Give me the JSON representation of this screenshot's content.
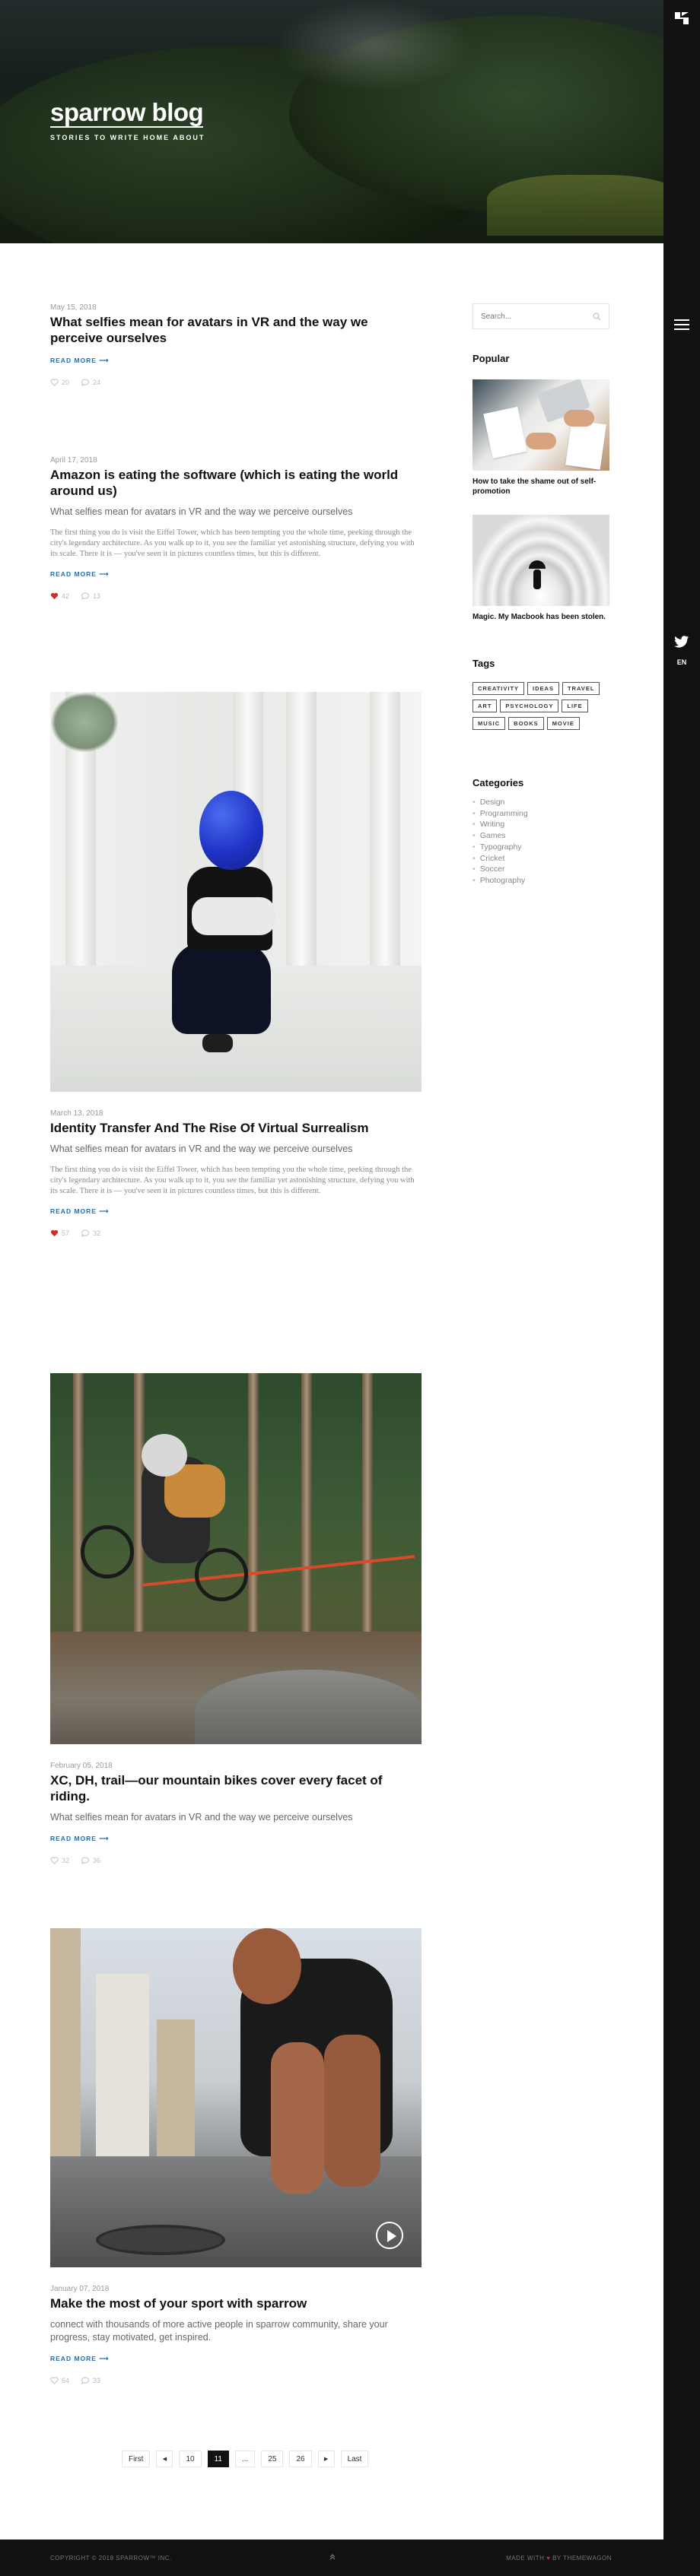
{
  "site": {
    "title": "sparrow blog",
    "tagline": "STORIES TO WRITE HOME ABOUT"
  },
  "rail": {
    "logo_icon": "sparrow-logo-icon",
    "menu_icon": "hamburger-icon",
    "social_icon": "twitter-icon",
    "language": "EN"
  },
  "posts": [
    {
      "date": "May 15, 2018",
      "title": "What selfies mean for avatars in VR and the way we perceive ourselves",
      "read_more": "READ MORE ⟶",
      "likes": "20",
      "comments": "24",
      "liked": false
    },
    {
      "date": "April 17, 2018",
      "title": "Amazon is eating the software (which is eating the world around us)",
      "subtitle": "What selfies mean for avatars in VR and the way we perceive ourselves",
      "excerpt": "The first thing you do is visit the Eiffel Tower, which has been tempting you the whole time, peeking through the city's legendary architecture. As you walk up to it, you see the familiar yet astonishing structure, defying you with its scale. There it is — you've seen it in pictures countless times, but this is different.",
      "read_more": "READ MORE ⟶",
      "likes": "42",
      "comments": "13",
      "liked": true
    },
    {
      "date": "March 13, 2018",
      "title": "Identity Transfer And The Rise Of Virtual Surrealism",
      "subtitle": "What selfies mean for avatars in VR and the way we perceive ourselves",
      "excerpt": "The first thing you do is visit the Eiffel Tower, which has been tempting you the whole time, peeking through the city's legendary architecture. As you walk up to it, you see the familiar yet astonishing structure, defying you with its scale. There it is — you've seen it in pictures countless times, but this is different.",
      "read_more": "READ MORE ⟶",
      "likes": "57",
      "comments": "32",
      "liked": true
    },
    {
      "date": "February 05, 2018",
      "title": "XC, DH, trail—our mountain bikes cover every facet of riding.",
      "subtitle": "What selfies mean for avatars in VR and the way we perceive ourselves",
      "read_more": "READ MORE ⟶",
      "likes": "32",
      "comments": "36",
      "liked": false
    },
    {
      "date": "January 07, 2018",
      "title": "Make the most of your sport with sparrow",
      "subtitle": "connect with thousands of more active people in sparrow community, share your progress, stay motivated, get inspired.",
      "read_more": "READ MORE ⟶",
      "likes": "64",
      "comments": "33",
      "liked": false
    }
  ],
  "sidebar": {
    "search_placeholder": "Search...",
    "popular_heading": "Popular",
    "popular": [
      {
        "title": "How to take the shame out of self-promotion"
      },
      {
        "title": "Magic. My Macbook has been stolen."
      }
    ],
    "tags_heading": "Tags",
    "tags": [
      "CREATIVITY",
      "IDEAS",
      "TRAVEL",
      "ART",
      "PSYCHOLOGY",
      "LIFE",
      "MUSIC",
      "BOOKS",
      "MOVIE"
    ],
    "categories_heading": "Categories",
    "categories": [
      "Design",
      "Programming",
      "Writing",
      "Games",
      "Typography",
      "Cricket",
      "Soccer",
      "Photography"
    ]
  },
  "pagination": {
    "first": "First",
    "prev": "◀",
    "pages": [
      "10",
      "11",
      "...",
      "25",
      "26"
    ],
    "current": "11",
    "next": "▶",
    "last": "Last"
  },
  "footer": {
    "copyright": "COPYRIGHT © 2018 SPARROW™ INC.",
    "made_prefix": "MADE WITH",
    "heart": "♥",
    "made_suffix": "BY THEMEWAGON"
  },
  "colors": {
    "accent": "#1f6fb2",
    "liked_heart": "#c9302c",
    "rail": "#111111"
  }
}
